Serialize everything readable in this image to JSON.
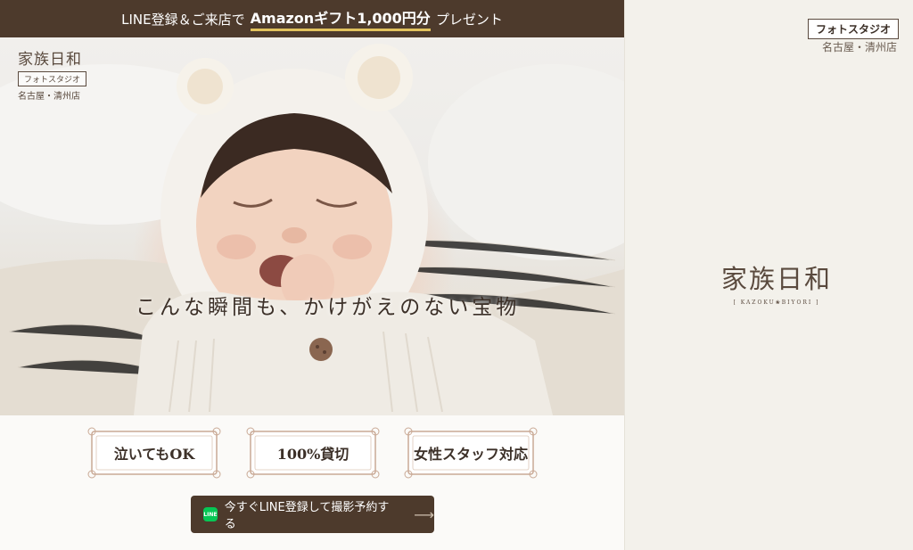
{
  "promo": {
    "prefix": "LINE登録＆ご来店で",
    "highlight": "Amazonギフト1,000円分",
    "suffix": "プレゼント"
  },
  "brand": {
    "name": "家族日和",
    "tag": "フォトスタジオ",
    "store": "名古屋・清州店",
    "roman": "[ KAZOKU❀BIYORI ]"
  },
  "hero": {
    "copy": "こんな瞬間も、かけがえのない宝物"
  },
  "features": [
    {
      "label": "泣いてもOK"
    },
    {
      "label": "100%貸切"
    },
    {
      "label": "女性スタッフ対応"
    }
  ],
  "cta": {
    "icon_text": "LINE",
    "label": "今すぐLINE登録して撮影予約する",
    "arrow": "⟶"
  },
  "colors": {
    "brown": "#4d3a2c",
    "gold": "#e2c25d",
    "line_green": "#06c755"
  }
}
